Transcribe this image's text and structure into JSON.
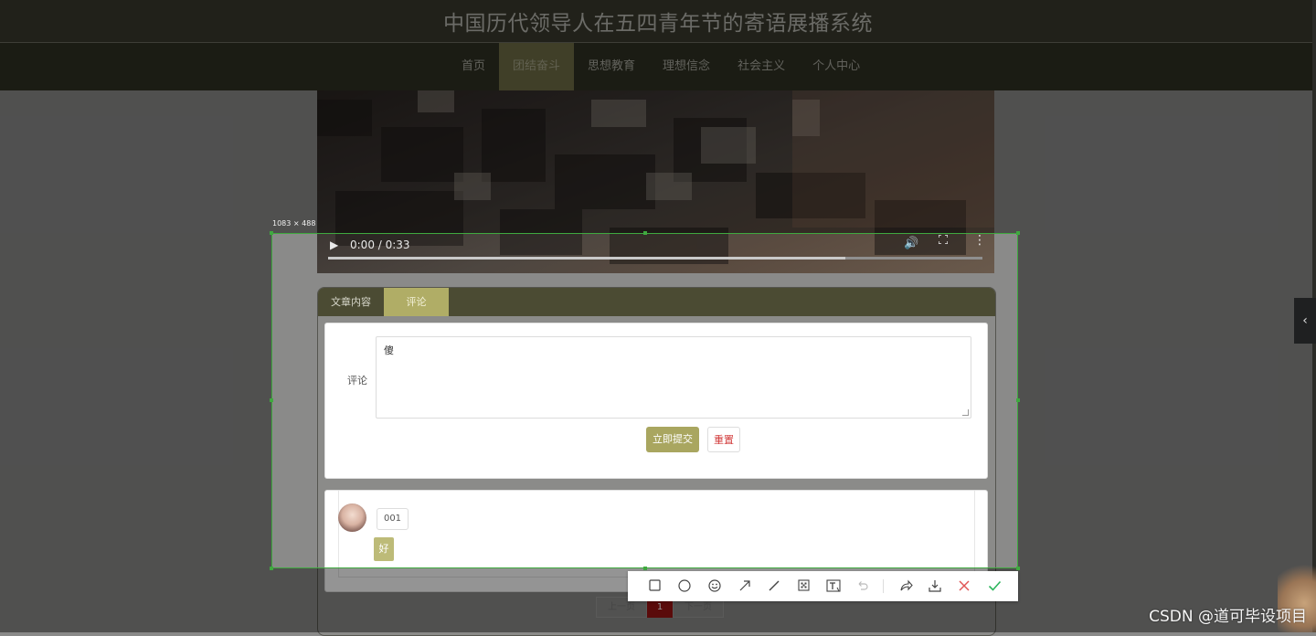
{
  "header": {
    "title": "中国历代领导人在五四青年节的寄语展播系统"
  },
  "nav": {
    "items": [
      {
        "label": "首页",
        "active": false
      },
      {
        "label": "团结奋斗",
        "active": true
      },
      {
        "label": "思想教育",
        "active": false
      },
      {
        "label": "理想信念",
        "active": false
      },
      {
        "label": "社会主义",
        "active": false
      },
      {
        "label": "个人中心",
        "active": false
      }
    ]
  },
  "video": {
    "time": "0:00 / 0:33",
    "progress_fraction": 0.79
  },
  "tabs": {
    "content_label": "文章内容",
    "comment_label": "评论"
  },
  "comment_form": {
    "label": "评论",
    "value": "傻",
    "submit_label": "立即提交",
    "reset_label": "重置"
  },
  "comments": [
    {
      "user": "001",
      "text": "好"
    }
  ],
  "pagination": {
    "prev": "上一页",
    "current": "1",
    "next": "下一页"
  },
  "capture": {
    "size_label": "1083 × 488"
  },
  "watermark": {
    "text": "CSDN @道可毕设项目"
  },
  "colors": {
    "accent": "#b0ad66",
    "header_bg": "#393a2d",
    "selection": "#3fa93f",
    "page_current": "#9b1414"
  }
}
